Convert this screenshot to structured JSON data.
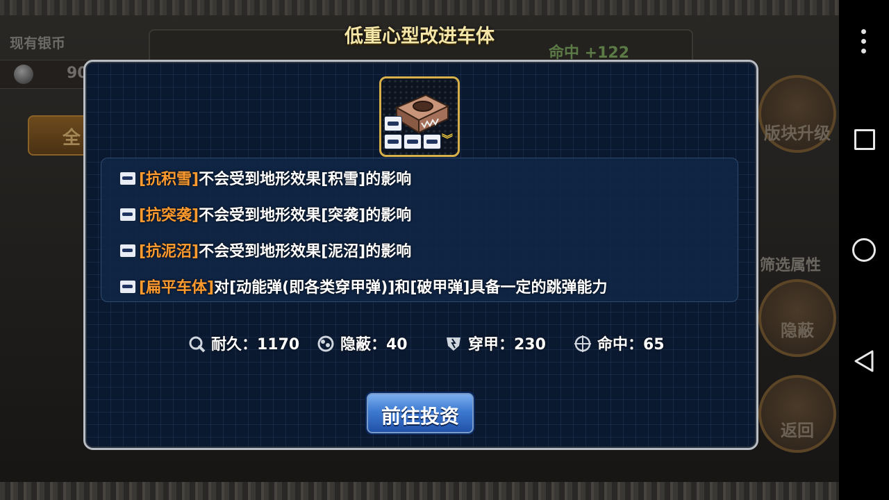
{
  "background": {
    "silver_label": "现有银币",
    "silver_value": "90",
    "all_button": "全",
    "hit_stat": "命中 +122",
    "module_upgrade": "版块升级",
    "filter_label": "筛选属性",
    "stealth_button": "隐蔽",
    "back_button": "返回"
  },
  "dialog": {
    "title": "低重心型改进车体",
    "effects": [
      {
        "icon": "track-icon",
        "tag": "[抗积雪]",
        "text": "不会受到地形效果[积雪]的影响"
      },
      {
        "icon": "tank-icon",
        "tag": "[抗突袭]",
        "text": "不会受到地形效果[突袭]的影响"
      },
      {
        "icon": "tank-gun-icon",
        "tag": "[抗泥沼]",
        "text": "不会受到地形效果[泥沼]的影响"
      },
      {
        "icon": "tank-icon",
        "tag": "[扁平车体]",
        "text": "对[动能弹(即各类穿甲弹)]和[破甲弹]具备一定的跳弹能力"
      }
    ],
    "stats": {
      "durability": "耐久：1170",
      "stealth": "隐蔽：40",
      "penetration": "穿甲：230",
      "accuracy": "命中：65"
    },
    "go_button": "前往投资"
  },
  "colors": {
    "tag_orange": "#ff9a2e",
    "title_gold": "#f3e6a8",
    "button_blue": "#3e7ad1",
    "panel_navy": "#0b1930"
  }
}
